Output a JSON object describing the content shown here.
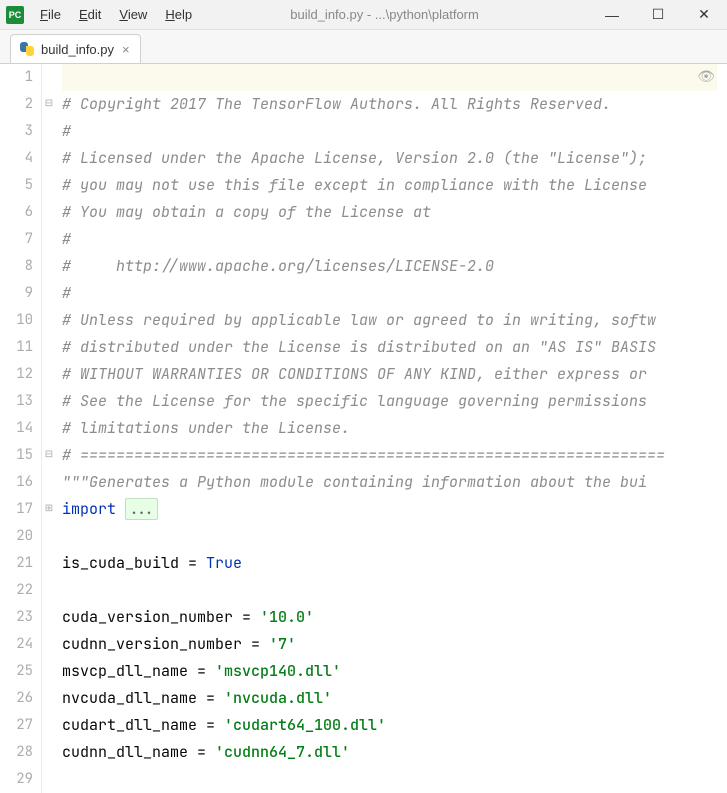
{
  "app_icon_text": "PC",
  "menubar": {
    "file": "File",
    "edit": "Edit",
    "view": "View",
    "help": "Help"
  },
  "window_title": "build_info.py - ...\\python\\platform",
  "tab": {
    "label": "build_info.py",
    "close": "×"
  },
  "window_controls": {
    "min": "—",
    "max": "☐",
    "close": "✕"
  },
  "inspection_icon": "👁",
  "line_numbers": [
    "1",
    "2",
    "3",
    "4",
    "5",
    "6",
    "7",
    "8",
    "9",
    "10",
    "11",
    "12",
    "13",
    "14",
    "15",
    "16",
    "17",
    "20",
    "21",
    "22",
    "23",
    "24",
    "25",
    "26",
    "27",
    "28",
    "29"
  ],
  "fold_marks": [
    {
      "line_index": 1,
      "glyph": "⊟"
    },
    {
      "line_index": 14,
      "glyph": "⊟"
    },
    {
      "line_index": 16,
      "glyph": "⊞"
    }
  ],
  "code_lines": [
    {
      "type": "blank",
      "hl": true,
      "text": ""
    },
    {
      "type": "comment",
      "text": "# Copyright 2017 The TensorFlow Authors. All Rights Reserved."
    },
    {
      "type": "comment",
      "text": "#"
    },
    {
      "type": "comment",
      "text": "# Licensed under the Apache License, Version 2.0 (the \"License\");"
    },
    {
      "type": "comment",
      "text": "# you may not use this file except in compliance with the License"
    },
    {
      "type": "comment",
      "text": "# You may obtain a copy of the License at"
    },
    {
      "type": "comment",
      "text": "#"
    },
    {
      "type": "comment",
      "text": "#     http://www.apache.org/licenses/LICENSE-2.0"
    },
    {
      "type": "comment",
      "text": "#"
    },
    {
      "type": "comment",
      "text": "# Unless required by applicable law or agreed to in writing, softw"
    },
    {
      "type": "comment",
      "text": "# distributed under the License is distributed on an \"AS IS\" BASIS"
    },
    {
      "type": "comment",
      "text": "# WITHOUT WARRANTIES OR CONDITIONS OF ANY KIND, either express or "
    },
    {
      "type": "comment",
      "text": "# See the License for the specific language governing permissions "
    },
    {
      "type": "comment",
      "text": "# limitations under the License."
    },
    {
      "type": "comment",
      "text": "# ================================================================="
    },
    {
      "type": "docstring",
      "text": "\"\"\"Generates a Python module containing information about the bui"
    },
    {
      "type": "fold",
      "prefix": "import ",
      "fold": "..."
    },
    {
      "type": "blank",
      "text": ""
    },
    {
      "type": "assign_kw",
      "lhs": "is_cuda_build = ",
      "kw": "True"
    },
    {
      "type": "blank",
      "text": ""
    },
    {
      "type": "assign_str",
      "lhs": "cuda_version_number = ",
      "str": "'10.0'"
    },
    {
      "type": "assign_str",
      "lhs": "cudnn_version_number = ",
      "str": "'7'"
    },
    {
      "type": "assign_str",
      "lhs": "msvcp_dll_name = ",
      "str": "'msvcp140.dll'"
    },
    {
      "type": "assign_str",
      "lhs": "nvcuda_dll_name = ",
      "str": "'nvcuda.dll'"
    },
    {
      "type": "assign_str",
      "lhs": "cudart_dll_name = ",
      "str": "'cudart64_100.dll'"
    },
    {
      "type": "assign_str",
      "lhs": "cudnn_dll_name = ",
      "str": "'cudnn64_7.dll'"
    },
    {
      "type": "blank",
      "text": ""
    }
  ]
}
